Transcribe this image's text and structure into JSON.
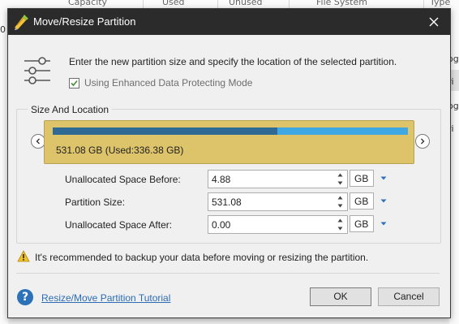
{
  "background_app": {
    "columns": [
      "Capacity",
      "Used",
      "Unused",
      "File System",
      "Type"
    ],
    "right_fragments": [
      "og",
      "ri",
      "og",
      "ri"
    ],
    "left_fragment": "0"
  },
  "dialog": {
    "title": "Move/Resize Partition",
    "app_icon": "minitool-partition-icon",
    "close_icon": "close-icon",
    "intro_text": "Enter the new partition size and specify the location of the selected partition.",
    "enhanced_mode": {
      "label": "Using Enhanced Data Protecting Mode",
      "checked": true
    },
    "group_label": "Size And Location",
    "partition": {
      "label": "531.08 GB (Used:336.38 GB)",
      "used_fraction": 0.633,
      "colors": {
        "fill": "#ddc36a",
        "used": "#2e6a93",
        "free": "#3fa7e1"
      }
    },
    "fields": [
      {
        "label": "Unallocated Space Before:",
        "value": "4.88",
        "unit": "GB"
      },
      {
        "label": "Partition Size:",
        "value": "531.08",
        "unit": "GB"
      },
      {
        "label": "Unallocated Space After:",
        "value": "0.00",
        "unit": "GB"
      }
    ],
    "warning": "It's recommended to backup your data before moving or resizing the partition.",
    "help_link": "Resize/Move Partition Tutorial",
    "buttons": {
      "ok": "OK",
      "cancel": "Cancel"
    }
  }
}
